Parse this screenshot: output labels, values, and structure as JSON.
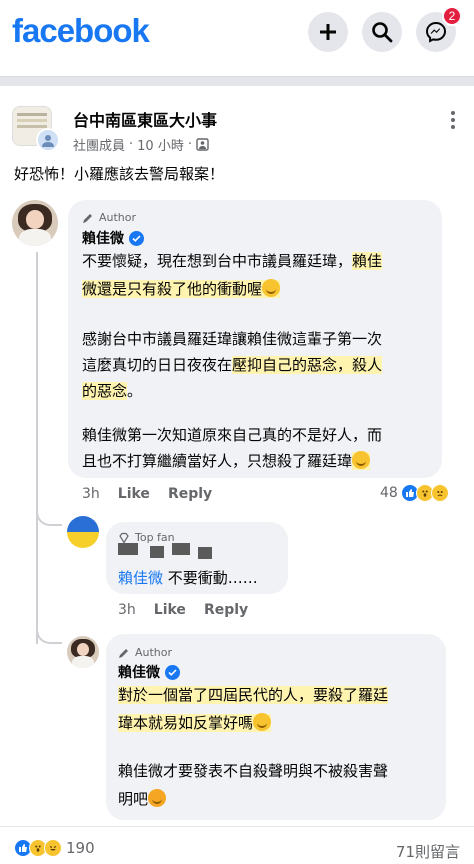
{
  "app": {
    "logo": "facebook",
    "notification_count": "2"
  },
  "post": {
    "group_name": "台中南區東區大小事",
    "role": "社團成員",
    "time": "10 小時",
    "text": "好恐怖！小羅應該去警局報案！"
  },
  "comments": [
    {
      "tag": "Author",
      "name": "賴佳微",
      "lines": [
        "不要懷疑，現在想到台中市議員羅廷瑋，",
        "賴佳",
        "微還是只有殺了他的衝動喔",
        "感謝台中市議員羅廷瑋讓賴佳微這輩子第一次",
        "這麼真切的日日夜夜在",
        "壓抑自己的惡念，殺人",
        "的惡念",
        "。",
        "賴佳微第一次知道原來自己真的不是好人，而",
        "且也不打算繼續當好人，只想殺了羅廷瑋"
      ],
      "time": "3h",
      "like": "Like",
      "reply": "Reply",
      "reaction_count": "48"
    },
    {
      "tag": "Top fan",
      "mention": "賴佳微",
      "text": " 不要衝動……",
      "time": "3h",
      "like": "Like",
      "reply": "Reply"
    },
    {
      "tag": "Author",
      "name": "賴佳微",
      "lines": [
        "對於一個當了四屆民代的人，要殺了羅廷",
        "瑋本就易如反掌好嗎",
        "賴佳微才要發表不自殺聲明與不被殺害聲",
        "明吧"
      ]
    }
  ],
  "footer": {
    "reaction_count": "190",
    "comment_count": "71則留言"
  },
  "colors": {
    "brand": "#1877f2",
    "highlight": "#fff3b0",
    "bubble": "#f0f2f5",
    "badge": "#e41e3f"
  }
}
